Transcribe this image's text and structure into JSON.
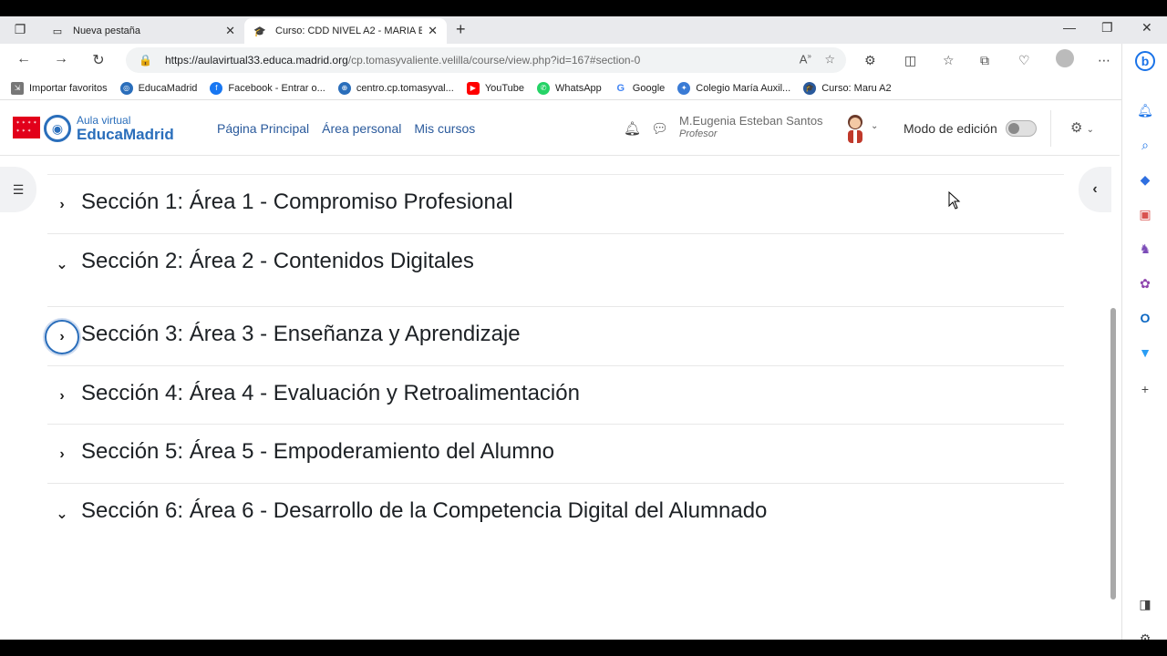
{
  "browser": {
    "tabs": [
      {
        "title": "Nueva pestaña",
        "icon": "new-tab-icon"
      },
      {
        "title": "Curso: CDD NIVEL A2 - MARIA E",
        "icon": "moodle-hat-icon"
      }
    ],
    "url": {
      "scheme": "https://",
      "host": "aulavirtual33.educa.madrid.org",
      "path": "/cp.tomasyvaliente.velilla/course/view.php?id=167#section-0"
    },
    "favorites": [
      {
        "label": "Importar favoritos",
        "icon": "import-icon",
        "color": "#555555"
      },
      {
        "label": "EducaMadrid",
        "icon": "educamadrid-icon",
        "color": "#2a6ebb"
      },
      {
        "label": "Facebook - Entrar o...",
        "icon": "facebook-icon",
        "color": "#1877f2"
      },
      {
        "label": "centro.cp.tomasyval...",
        "icon": "globe-icon",
        "color": "#2a6ebb"
      },
      {
        "label": "YouTube",
        "icon": "youtube-icon",
        "color": "#ff0000"
      },
      {
        "label": "WhatsApp",
        "icon": "whatsapp-icon",
        "color": "#25d366"
      },
      {
        "label": "Google",
        "icon": "google-icon",
        "color": "#4285f4"
      },
      {
        "label": "Colegio María Auxil...",
        "icon": "colegio-icon",
        "color": "#3a7bd5"
      },
      {
        "label": "Curso: Maru A2",
        "icon": "moodle-hat-icon",
        "color": "#2a5a9c"
      }
    ]
  },
  "site": {
    "logo_top": "Aula virtual",
    "logo_bottom": "EducaMadrid",
    "nav": [
      "Página Principal",
      "Área personal",
      "Mis cursos"
    ],
    "user_name": "M.Eugenia Esteban Santos",
    "user_role": "Profesor",
    "edit_mode_label": "Modo de edición",
    "edit_mode_on": false
  },
  "sections": [
    {
      "title": "Sección 1: Área 1 - Compromiso Profesional",
      "expanded": false,
      "focused": false
    },
    {
      "title": "Sección 2: Área 2 - Contenidos Digitales",
      "expanded": true,
      "focused": false
    },
    {
      "title": "Sección 3: Área 3 - Enseñanza y Aprendizaje",
      "expanded": false,
      "focused": true
    },
    {
      "title": "Sección 4: Área 4 - Evaluación y Retroalimentación",
      "expanded": false,
      "focused": false
    },
    {
      "title": "Sección 5: Área 5 - Empoderamiento del Alumno",
      "expanded": false,
      "focused": false
    },
    {
      "title": "Sección 6: Área 6 - Desarrollo de la Competencia Digital del Alumnado",
      "expanded": true,
      "focused": false
    }
  ],
  "colors": {
    "accent": "#2a6ebb",
    "brand_red": "#e2001a"
  }
}
